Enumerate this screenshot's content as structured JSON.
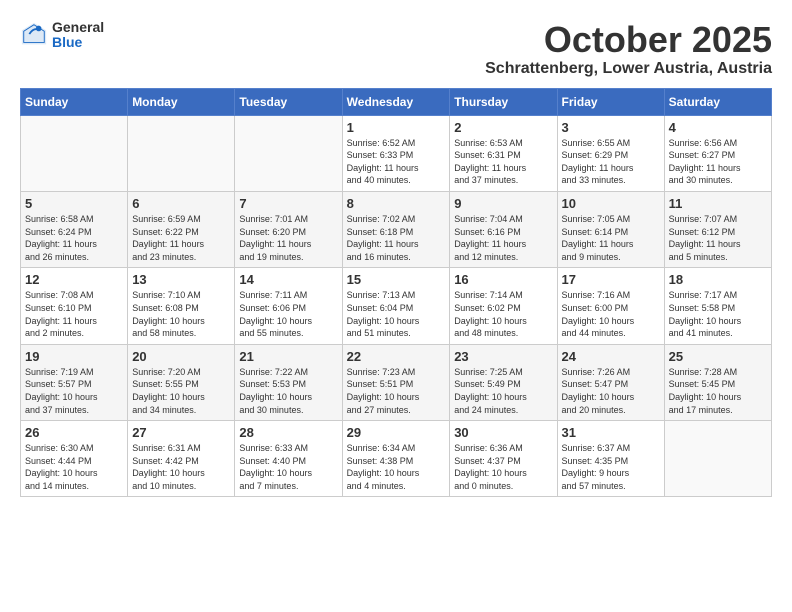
{
  "header": {
    "logo_general": "General",
    "logo_blue": "Blue",
    "month": "October 2025",
    "location": "Schrattenberg, Lower Austria, Austria"
  },
  "days_of_week": [
    "Sunday",
    "Monday",
    "Tuesday",
    "Wednesday",
    "Thursday",
    "Friday",
    "Saturday"
  ],
  "weeks": [
    [
      {
        "day": "",
        "info": ""
      },
      {
        "day": "",
        "info": ""
      },
      {
        "day": "",
        "info": ""
      },
      {
        "day": "1",
        "info": "Sunrise: 6:52 AM\nSunset: 6:33 PM\nDaylight: 11 hours\nand 40 minutes."
      },
      {
        "day": "2",
        "info": "Sunrise: 6:53 AM\nSunset: 6:31 PM\nDaylight: 11 hours\nand 37 minutes."
      },
      {
        "day": "3",
        "info": "Sunrise: 6:55 AM\nSunset: 6:29 PM\nDaylight: 11 hours\nand 33 minutes."
      },
      {
        "day": "4",
        "info": "Sunrise: 6:56 AM\nSunset: 6:27 PM\nDaylight: 11 hours\nand 30 minutes."
      }
    ],
    [
      {
        "day": "5",
        "info": "Sunrise: 6:58 AM\nSunset: 6:24 PM\nDaylight: 11 hours\nand 26 minutes."
      },
      {
        "day": "6",
        "info": "Sunrise: 6:59 AM\nSunset: 6:22 PM\nDaylight: 11 hours\nand 23 minutes."
      },
      {
        "day": "7",
        "info": "Sunrise: 7:01 AM\nSunset: 6:20 PM\nDaylight: 11 hours\nand 19 minutes."
      },
      {
        "day": "8",
        "info": "Sunrise: 7:02 AM\nSunset: 6:18 PM\nDaylight: 11 hours\nand 16 minutes."
      },
      {
        "day": "9",
        "info": "Sunrise: 7:04 AM\nSunset: 6:16 PM\nDaylight: 11 hours\nand 12 minutes."
      },
      {
        "day": "10",
        "info": "Sunrise: 7:05 AM\nSunset: 6:14 PM\nDaylight: 11 hours\nand 9 minutes."
      },
      {
        "day": "11",
        "info": "Sunrise: 7:07 AM\nSunset: 6:12 PM\nDaylight: 11 hours\nand 5 minutes."
      }
    ],
    [
      {
        "day": "12",
        "info": "Sunrise: 7:08 AM\nSunset: 6:10 PM\nDaylight: 11 hours\nand 2 minutes."
      },
      {
        "day": "13",
        "info": "Sunrise: 7:10 AM\nSunset: 6:08 PM\nDaylight: 10 hours\nand 58 minutes."
      },
      {
        "day": "14",
        "info": "Sunrise: 7:11 AM\nSunset: 6:06 PM\nDaylight: 10 hours\nand 55 minutes."
      },
      {
        "day": "15",
        "info": "Sunrise: 7:13 AM\nSunset: 6:04 PM\nDaylight: 10 hours\nand 51 minutes."
      },
      {
        "day": "16",
        "info": "Sunrise: 7:14 AM\nSunset: 6:02 PM\nDaylight: 10 hours\nand 48 minutes."
      },
      {
        "day": "17",
        "info": "Sunrise: 7:16 AM\nSunset: 6:00 PM\nDaylight: 10 hours\nand 44 minutes."
      },
      {
        "day": "18",
        "info": "Sunrise: 7:17 AM\nSunset: 5:58 PM\nDaylight: 10 hours\nand 41 minutes."
      }
    ],
    [
      {
        "day": "19",
        "info": "Sunrise: 7:19 AM\nSunset: 5:57 PM\nDaylight: 10 hours\nand 37 minutes."
      },
      {
        "day": "20",
        "info": "Sunrise: 7:20 AM\nSunset: 5:55 PM\nDaylight: 10 hours\nand 34 minutes."
      },
      {
        "day": "21",
        "info": "Sunrise: 7:22 AM\nSunset: 5:53 PM\nDaylight: 10 hours\nand 30 minutes."
      },
      {
        "day": "22",
        "info": "Sunrise: 7:23 AM\nSunset: 5:51 PM\nDaylight: 10 hours\nand 27 minutes."
      },
      {
        "day": "23",
        "info": "Sunrise: 7:25 AM\nSunset: 5:49 PM\nDaylight: 10 hours\nand 24 minutes."
      },
      {
        "day": "24",
        "info": "Sunrise: 7:26 AM\nSunset: 5:47 PM\nDaylight: 10 hours\nand 20 minutes."
      },
      {
        "day": "25",
        "info": "Sunrise: 7:28 AM\nSunset: 5:45 PM\nDaylight: 10 hours\nand 17 minutes."
      }
    ],
    [
      {
        "day": "26",
        "info": "Sunrise: 6:30 AM\nSunset: 4:44 PM\nDaylight: 10 hours\nand 14 minutes."
      },
      {
        "day": "27",
        "info": "Sunrise: 6:31 AM\nSunset: 4:42 PM\nDaylight: 10 hours\nand 10 minutes."
      },
      {
        "day": "28",
        "info": "Sunrise: 6:33 AM\nSunset: 4:40 PM\nDaylight: 10 hours\nand 7 minutes."
      },
      {
        "day": "29",
        "info": "Sunrise: 6:34 AM\nSunset: 4:38 PM\nDaylight: 10 hours\nand 4 minutes."
      },
      {
        "day": "30",
        "info": "Sunrise: 6:36 AM\nSunset: 4:37 PM\nDaylight: 10 hours\nand 0 minutes."
      },
      {
        "day": "31",
        "info": "Sunrise: 6:37 AM\nSunset: 4:35 PM\nDaylight: 9 hours\nand 57 minutes."
      },
      {
        "day": "",
        "info": ""
      }
    ]
  ]
}
